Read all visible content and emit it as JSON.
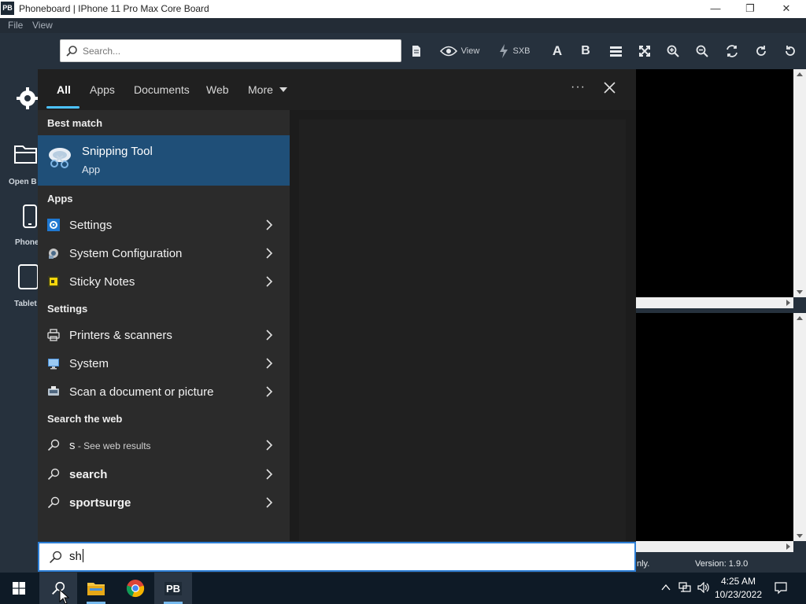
{
  "window": {
    "logo": "PB",
    "title": "Phoneboard | IPhone 11 Pro Max Core Board",
    "menu": [
      "File",
      "View"
    ]
  },
  "toolbar": {
    "search_placeholder": "Search...",
    "view_label": "View",
    "sxb_label": "SXB",
    "font_a_label": "A",
    "bold_label": "B"
  },
  "sidebar": {
    "open_label": "Open B",
    "phone_label": "Phone",
    "tablet_label": "Tablet"
  },
  "status": {
    "left_fragment": "nly.",
    "version": "Version: 1.9.0"
  },
  "search_panel": {
    "tabs": [
      "All",
      "Apps",
      "Documents",
      "Web",
      "More"
    ],
    "active_tab": "All",
    "more_menu_glyph": "···",
    "best_match_heading": "Best match",
    "best_match": {
      "title": "Snipping Tool",
      "subtitle": "App"
    },
    "apps_heading": "Apps",
    "apps": [
      "Settings",
      "System Configuration",
      "Sticky Notes"
    ],
    "settings_heading": "Settings",
    "settings": [
      "Printers & scanners",
      "System",
      "Scan a document or picture"
    ],
    "web_heading": "Search the web",
    "web": [
      {
        "label": "s",
        "suffix": " - See web results"
      },
      {
        "label": "search",
        "suffix": ""
      },
      {
        "label": "sportsurge",
        "suffix": ""
      }
    ],
    "query": "sh"
  },
  "taskbar": {
    "pb_label": "PB",
    "time": "4:25 AM",
    "date": "10/23/2022"
  },
  "colors": {
    "accent": "#4cc2ff",
    "best_match_bg": "#1f4f78",
    "search_border": "#2d7fd6"
  }
}
